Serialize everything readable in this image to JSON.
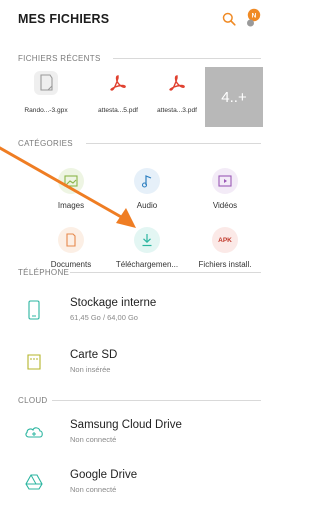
{
  "header": {
    "title": "MES FICHIERS",
    "notification_badge": "N"
  },
  "recent": {
    "label": "FICHIERS RÉCENTS",
    "items": [
      {
        "name": "Rando...-3.gpx",
        "icon": "gpx-file-icon"
      },
      {
        "name": "attesta...5.pdf",
        "icon": "pdf-file-icon"
      },
      {
        "name": "attesta...3.pdf",
        "icon": "pdf-file-icon"
      }
    ],
    "more": "4..+"
  },
  "categories": {
    "label": "CATÉGORIES",
    "items": [
      {
        "label": "Images",
        "icon": "image-icon",
        "color": "#8bb54a"
      },
      {
        "label": "Audio",
        "icon": "music-note-icon",
        "color": "#2d7fc0"
      },
      {
        "label": "Vidéos",
        "icon": "video-icon",
        "color": "#9b59b6"
      },
      {
        "label": "Documents",
        "icon": "document-icon",
        "color": "#e6884c"
      },
      {
        "label": "Téléchargemen...",
        "icon": "download-icon",
        "color": "#2bb5a0"
      },
      {
        "label": "Fichiers install.",
        "icon": "apk-icon",
        "color": "#c0392b",
        "badge": "APK"
      }
    ]
  },
  "phone": {
    "label": "TÉLÉPHONE",
    "items": [
      {
        "name": "Stockage interne",
        "detail": "61,45 Go / 64,00 Go"
      },
      {
        "name": "Carte SD",
        "detail": "Non insérée"
      }
    ]
  },
  "cloud": {
    "label": "CLOUD",
    "items": [
      {
        "name": "Samsung Cloud Drive",
        "detail": "Non connecté"
      },
      {
        "name": "Google Drive",
        "detail": "Non connecté"
      }
    ]
  },
  "colors": {
    "accent_orange": "#f08a24",
    "arrow": "#ef7d23"
  }
}
